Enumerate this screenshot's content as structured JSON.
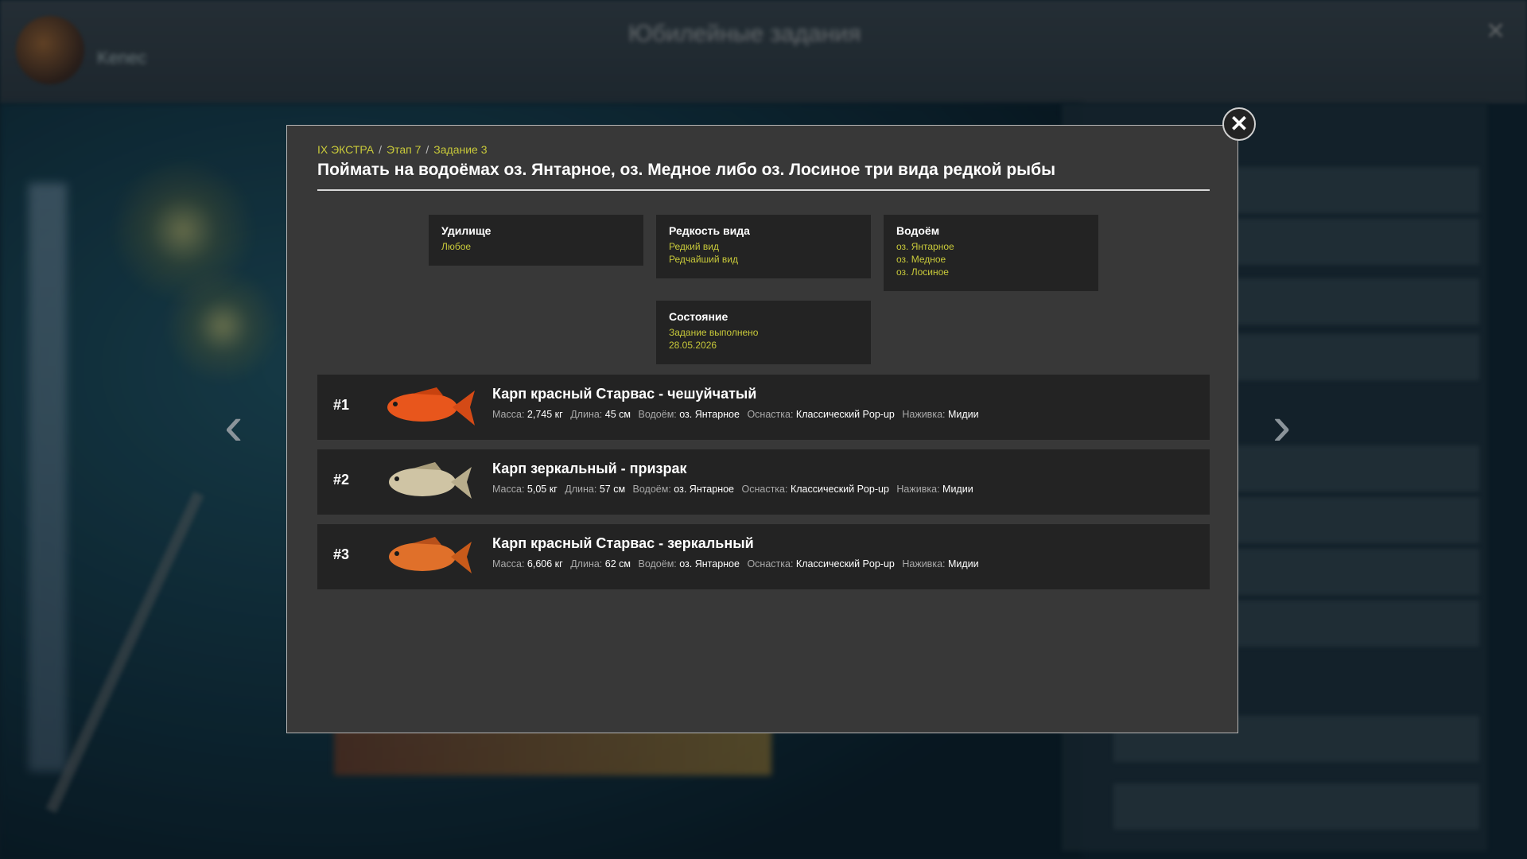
{
  "background": {
    "title": "Юбилейные задания",
    "player_name": "Kenec"
  },
  "modal": {
    "breadcrumb": [
      "IX ЭКСТРА",
      "Этап 7",
      "Задание 3"
    ],
    "breadcrumb_sep": "/",
    "title": "Поймать на водоёмах оз. Янтарное, оз. Медное либо оз. Лосиное три вида редкой рыбы",
    "close_icon": "close-icon"
  },
  "info": {
    "rod": {
      "label": "Удилище",
      "values": [
        "Любое"
      ]
    },
    "rarity": {
      "label": "Редкость вида",
      "values": [
        "Редкий вид",
        "Редчайший вид"
      ]
    },
    "waterbody": {
      "label": "Водоём",
      "values": [
        "оз. Янтарное",
        "оз. Медное",
        "оз. Лосиное"
      ]
    },
    "status": {
      "label": "Состояние",
      "values": [
        "Задание выполнено",
        "28.05.2026"
      ]
    }
  },
  "labels": {
    "mass": "Масса:",
    "length": "Длина:",
    "water": "Водоём:",
    "tackle": "Оснастка:",
    "bait": "Наживка:"
  },
  "fish": [
    {
      "num": "#1",
      "name": "Карп красный Старвас - чешуйчатый",
      "mass": "2,745 кг",
      "length": "45 см",
      "water": "оз. Янтарное",
      "tackle": "Классический Pop-up",
      "bait": "Мидии",
      "color": "#e8561c"
    },
    {
      "num": "#2",
      "name": "Карп зеркальный - призрак",
      "mass": "5,05 кг",
      "length": "57 см",
      "water": "оз. Янтарное",
      "tackle": "Классический Pop-up",
      "bait": "Мидии",
      "color": "#cfc4a4"
    },
    {
      "num": "#3",
      "name": "Карп красный Старвас - зеркальный",
      "mass": "6,606 кг",
      "length": "62 см",
      "water": "оз. Янтарное",
      "tackle": "Классический Pop-up",
      "bait": "Мидии",
      "color": "#e0702a"
    }
  ],
  "colors": {
    "accent": "#c8c93a",
    "panel": "#383838",
    "box": "#232323"
  }
}
